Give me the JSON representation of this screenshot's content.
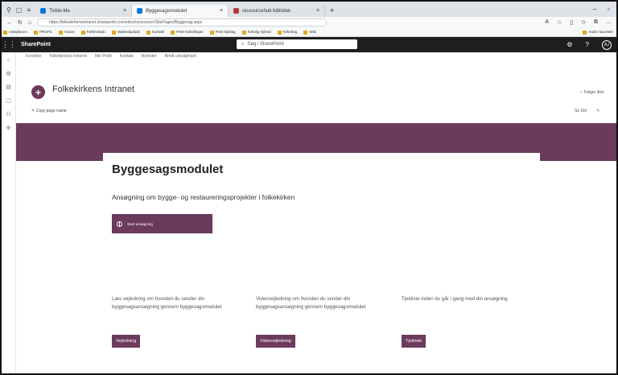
{
  "browser": {
    "tabs": [
      {
        "label": "Tickle-Me"
      },
      {
        "label": "Byggesagsmodulet"
      },
      {
        "label": "ressourcehub bibliotek"
      }
    ],
    "url": "https://folkekirkensintranet.sharepoint.com/sites/ressourcer/SitePages/Byggesag.aspx",
    "favorites": [
      "Arbejdsrum",
      "PROFIL",
      "Kasse",
      "Fællesskab",
      "Markedsplads",
      "Kontakt",
      "FKM Indstillinger",
      "FKM Opslag",
      "Kirkelig Nyhed",
      "Kirkebog",
      "Wiki"
    ],
    "favorites_other": "Andre favoritter"
  },
  "suitebar": {
    "brand": "SharePoint",
    "search_placeholder": "Søg i SharePoint",
    "avatar": "AJ"
  },
  "hubnav": [
    "Forsiden",
    "Folkekirkens Intranet",
    "Min Profil",
    "Kontakt",
    "Nyheder",
    "Bredt udvalgmant"
  ],
  "site": {
    "title": "Folkekirkens Intranet",
    "logo_glyph": "+",
    "follow_label": "Følger ikke",
    "command": "Copy page name",
    "publish": "Se Del"
  },
  "hero": {
    "title": "Byggesagsmodulet",
    "subtitle": "Ansøgning om bygge- og restaureringsprojekter i folkekirken",
    "start_button": "Start ansøgning"
  },
  "columns": [
    {
      "text": "Læs vejledning om hvordan du sender din byggesagsansøgning gennem byggesagsmodulet",
      "button": "Vejledning"
    },
    {
      "text": "Videovejledning om hvordan du sender din byggesagsansøgning gennem byggesagsmodulet",
      "button": "Videovejledning"
    },
    {
      "text": "Tjekliste inden du går i gang med din ansøgning",
      "button": "Tjekliste"
    }
  ],
  "colors": {
    "brand_purple": "#6b3a5c",
    "suitebar": "#1e1e1e"
  }
}
